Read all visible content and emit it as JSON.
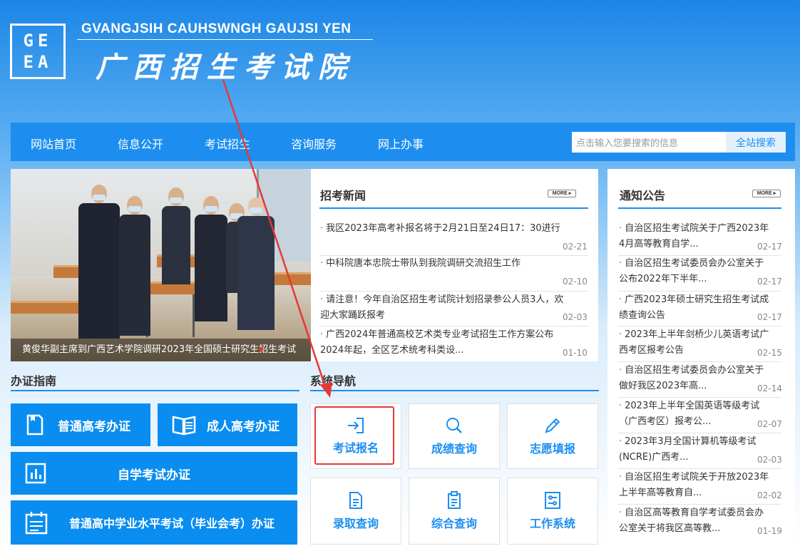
{
  "header": {
    "logo_text": "GEEA",
    "site_name_en": "GVANGJSIH CAUHSWNGH GAUJSI YEN",
    "site_name_cn": "广西招生考试院"
  },
  "nav": {
    "items": [
      {
        "label": "网站首页"
      },
      {
        "label": "信息公开"
      },
      {
        "label": "考试招生"
      },
      {
        "label": "咨询服务"
      },
      {
        "label": "网上办事"
      }
    ],
    "search_placeholder": "点击输入您要搜索的信息",
    "search_button": "全站搜索"
  },
  "slider": {
    "caption": "黄俊华副主席到广西艺术学院调研2023年全国硕士研究生招生考试"
  },
  "news": {
    "title": "招考新闻",
    "more": "MORE ▸",
    "items": [
      {
        "title": "我区2023年高考补报名将于2月21日至24日17：30进行",
        "date": "02-21"
      },
      {
        "title": "中科院唐本忠院士带队到我院调研交流招生工作",
        "date": "02-10"
      },
      {
        "title_line1": "请注意！今年自治区招生考试院计划招录参公人员3人，欢",
        "title_line2": "迎大家踊跃报考",
        "date": "02-03"
      },
      {
        "title_line1": "广西2024年普通高校艺术类专业考试招生工作方案公布",
        "title_line2": "2024年起，全区艺术统考科类设...",
        "date": "01-10"
      }
    ]
  },
  "notices": {
    "title": "通知公告",
    "more": "MORE ▸",
    "items": [
      {
        "line1": "自治区招生考试院关于广西2023年",
        "line2": "4月高等教育自学...",
        "date": "02-17"
      },
      {
        "line1": "自治区招生考试委员会办公室关于",
        "line2": "公布2022年下半年...",
        "date": "02-17"
      },
      {
        "line1": "广西2023年硕士研究生招生考试成",
        "line2": "绩查询公告",
        "date": "02-17"
      },
      {
        "line1": "2023年上半年剑桥少儿英语考试广",
        "line2": "西考区报考公告",
        "date": "02-15"
      },
      {
        "line1": "自治区招生考试委员会办公室关于",
        "line2": "做好我区2023年高...",
        "date": "02-14"
      },
      {
        "line1": "2023年上半年全国英语等级考试",
        "line2": "（广西考区）报考公...",
        "date": "02-07"
      },
      {
        "line1": "2023年3月全国计算机等级考试",
        "line2": "(NCRE)广西考...",
        "date": "02-03"
      },
      {
        "line1": "自治区招生考试院关于开放2023年",
        "line2": "上半年高等教育自...",
        "date": "02-02"
      },
      {
        "line1": "自治区高等教育自学考试委员会办",
        "line2": "公室关于将我区高等教...",
        "date": "01-19"
      }
    ]
  },
  "guide": {
    "title": "办证指南",
    "tiles": {
      "gaokao": "普通高考办证",
      "adult": "成人高考办证",
      "self": "自学考试办证",
      "huikao": "普通高中学业水平考试（毕业会考）办证"
    }
  },
  "system": {
    "title": "系统导航",
    "tiles": {
      "register": "考试报名",
      "score": "成绩查询",
      "volunteer": "志愿填报",
      "admission": "录取查询",
      "general": "综合查询",
      "work": "工作系统"
    }
  },
  "colors": {
    "primary": "#1d8ef0",
    "tile": "#0a8df0",
    "accent_red": "#e53935"
  }
}
